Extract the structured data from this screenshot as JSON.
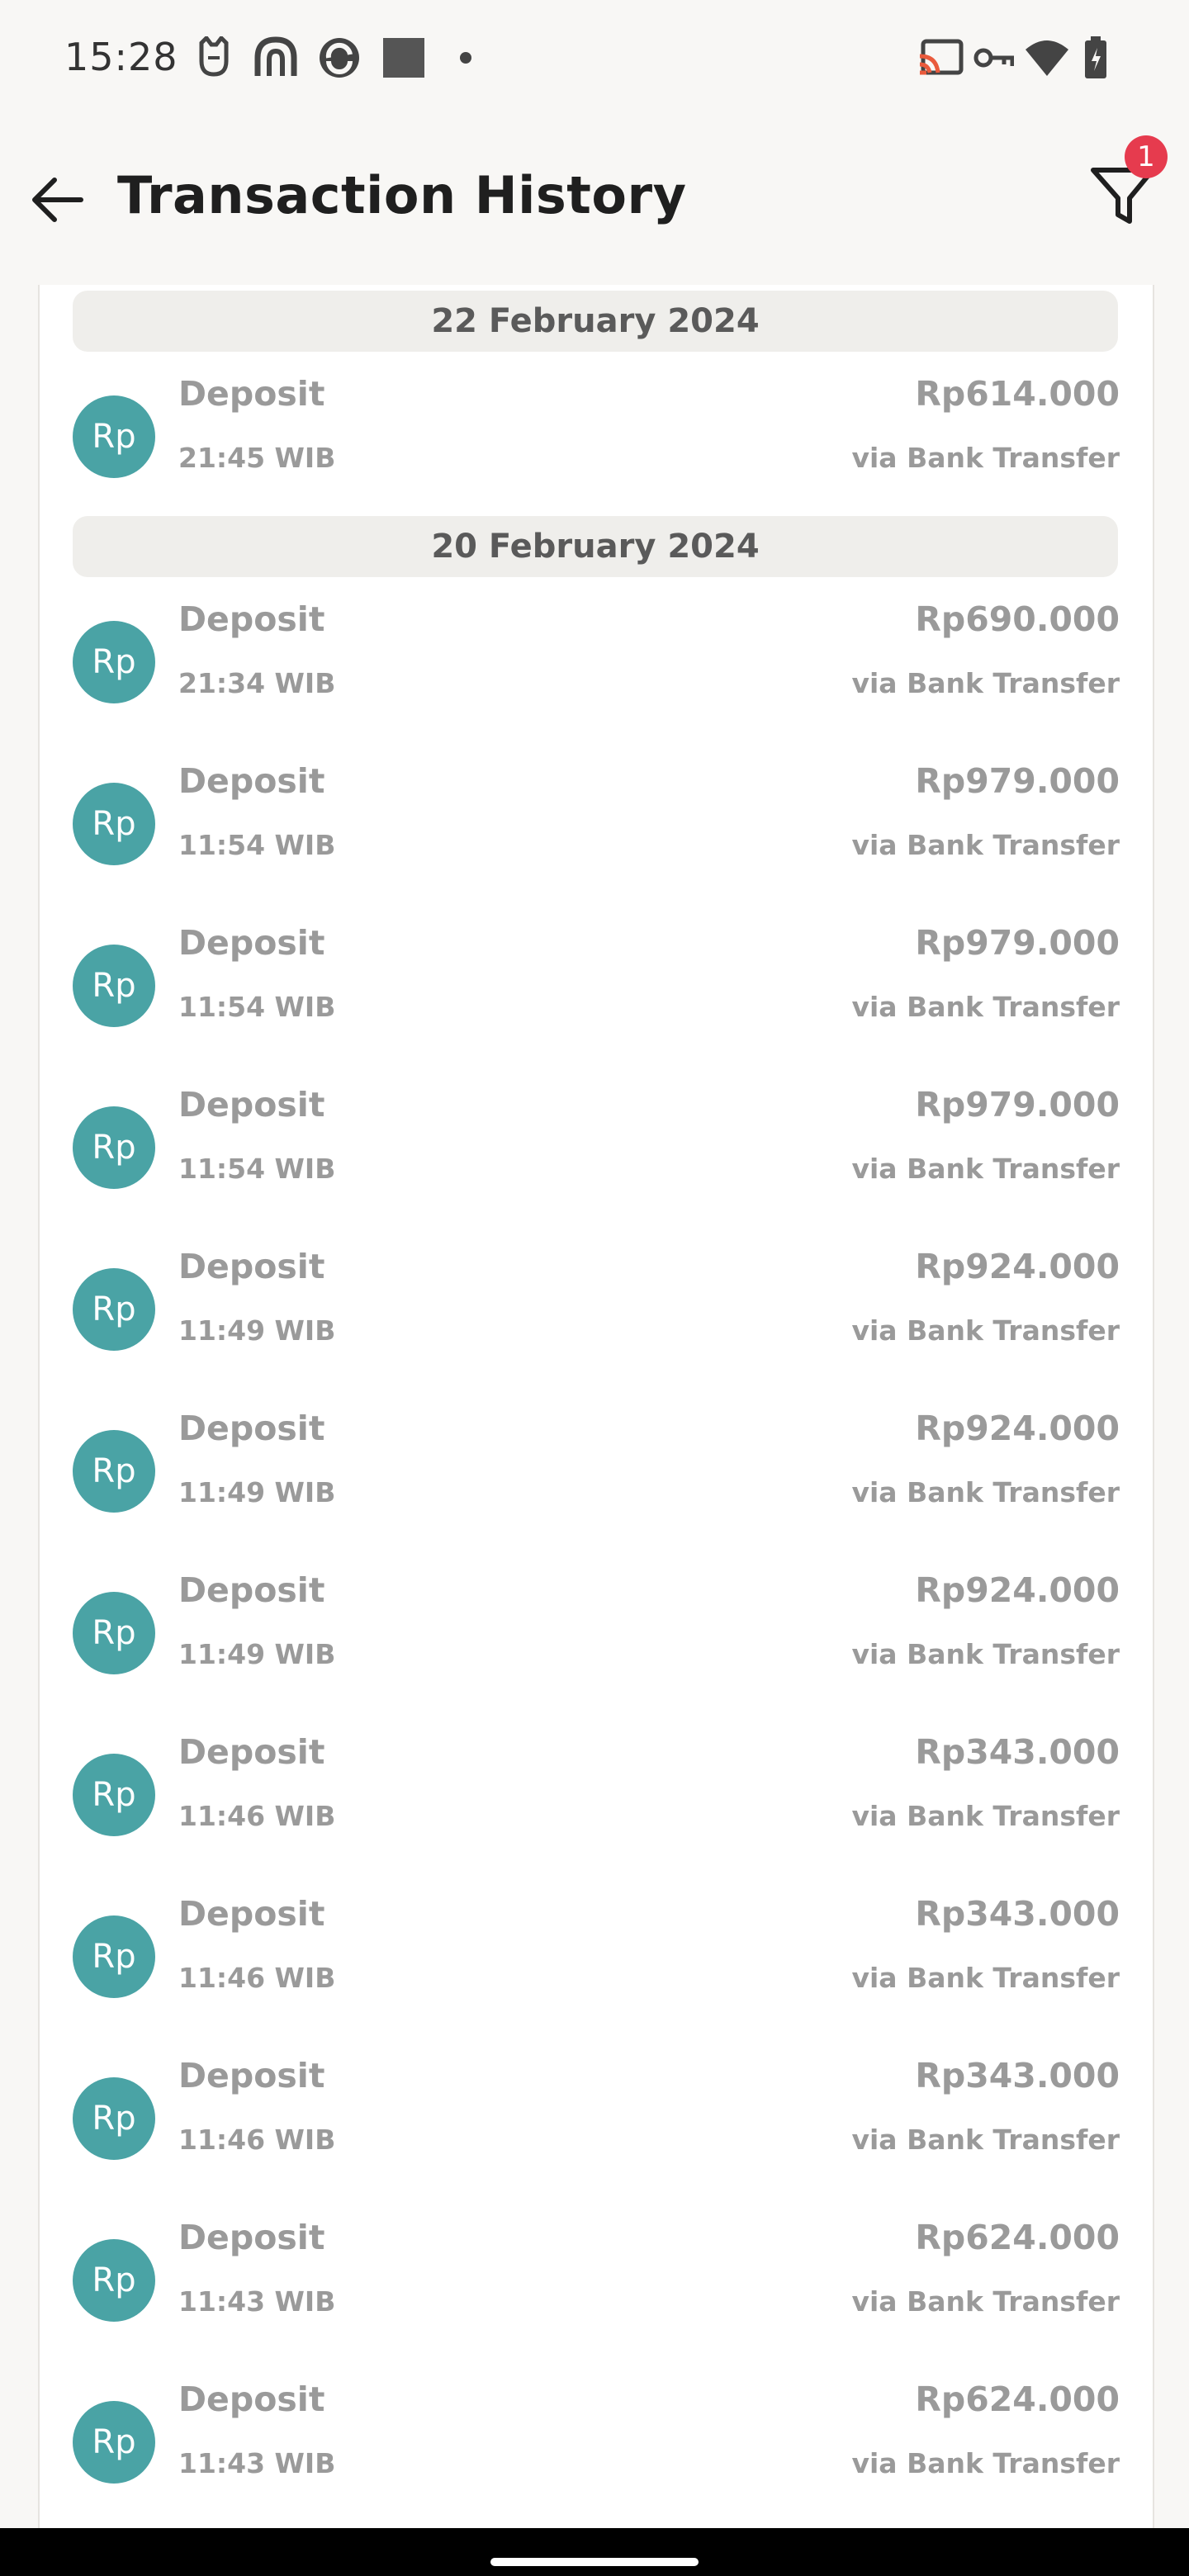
{
  "status_bar": {
    "time": "15:28",
    "icons": [
      "cat-notification-icon",
      "app-notification-icon",
      "sync-notification-icon",
      "square-notification-icon",
      "dot-icon",
      "cast-icon",
      "vpn-key-icon",
      "wifi-icon",
      "battery-icon"
    ]
  },
  "app_bar": {
    "title": "Transaction History",
    "filter_badge": "1"
  },
  "groups": [
    {
      "date": "22 February 2024",
      "items": [
        {
          "type": "Deposit",
          "time": "21:45 WIB",
          "amount": "Rp614.000",
          "method": "via Bank Transfer",
          "avatar": "Rp"
        }
      ]
    },
    {
      "date": "20 February 2024",
      "items": [
        {
          "type": "Deposit",
          "time": "21:34 WIB",
          "amount": "Rp690.000",
          "method": "via Bank Transfer",
          "avatar": "Rp"
        },
        {
          "type": "Deposit",
          "time": "11:54 WIB",
          "amount": "Rp979.000",
          "method": "via Bank Transfer",
          "avatar": "Rp"
        },
        {
          "type": "Deposit",
          "time": "11:54 WIB",
          "amount": "Rp979.000",
          "method": "via Bank Transfer",
          "avatar": "Rp"
        },
        {
          "type": "Deposit",
          "time": "11:54 WIB",
          "amount": "Rp979.000",
          "method": "via Bank Transfer",
          "avatar": "Rp"
        },
        {
          "type": "Deposit",
          "time": "11:49 WIB",
          "amount": "Rp924.000",
          "method": "via Bank Transfer",
          "avatar": "Rp"
        },
        {
          "type": "Deposit",
          "time": "11:49 WIB",
          "amount": "Rp924.000",
          "method": "via Bank Transfer",
          "avatar": "Rp"
        },
        {
          "type": "Deposit",
          "time": "11:49 WIB",
          "amount": "Rp924.000",
          "method": "via Bank Transfer",
          "avatar": "Rp"
        },
        {
          "type": "Deposit",
          "time": "11:46 WIB",
          "amount": "Rp343.000",
          "method": "via Bank Transfer",
          "avatar": "Rp"
        },
        {
          "type": "Deposit",
          "time": "11:46 WIB",
          "amount": "Rp343.000",
          "method": "via Bank Transfer",
          "avatar": "Rp"
        },
        {
          "type": "Deposit",
          "time": "11:46 WIB",
          "amount": "Rp343.000",
          "method": "via Bank Transfer",
          "avatar": "Rp"
        },
        {
          "type": "Deposit",
          "time": "11:43 WIB",
          "amount": "Rp624.000",
          "method": "via Bank Transfer",
          "avatar": "Rp"
        },
        {
          "type": "Deposit",
          "time": "11:43 WIB",
          "amount": "Rp624.000",
          "method": "via Bank Transfer",
          "avatar": "Rp"
        }
      ]
    }
  ],
  "colors": {
    "avatar_bg": "#4aa3a5",
    "badge_bg": "#e63b4e",
    "muted_text": "#9a9a9a",
    "title_text": "#1f1f1f"
  }
}
